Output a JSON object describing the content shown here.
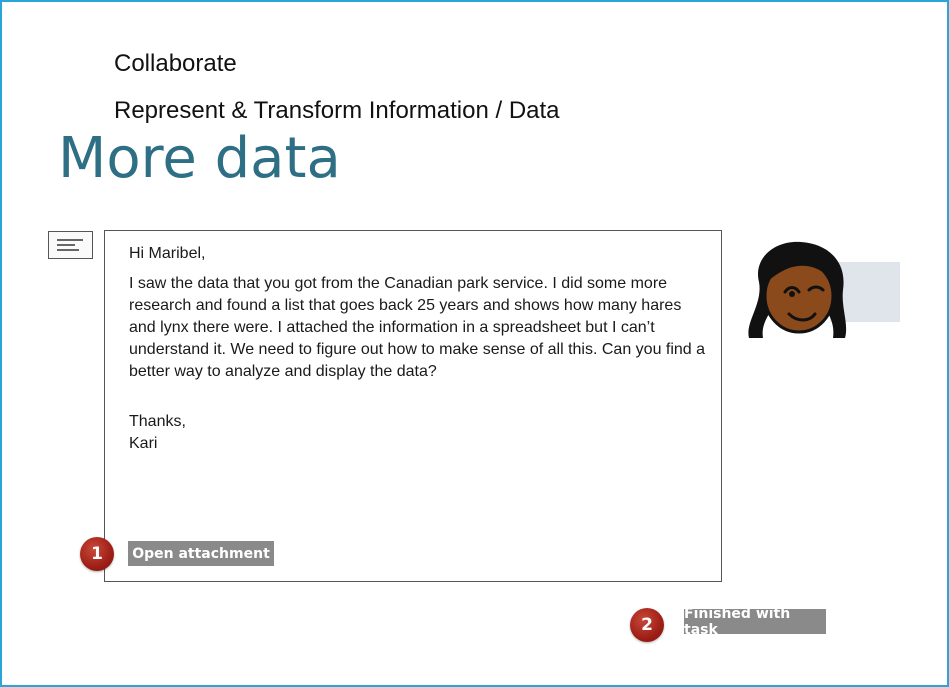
{
  "header": {
    "category": "Collaborate",
    "subcategory": "Represent & Transform Information / Data",
    "title": "More data"
  },
  "message": {
    "greeting": "Hi Maribel,",
    "body": "I saw the data that you got from the Canadian park service. I did some more research and found a list that goes back 25 years and shows how many hares and lynx there were. I attached the information in a spreadsheet but I can’t understand it. We need to figure out how to make sense of all this. Can you find a better way to analyze and display the data?",
    "signoff": "Thanks,",
    "signature": "Kari",
    "icon": "message-icon"
  },
  "steps": [
    {
      "number": "1",
      "label": "Open attachment"
    },
    {
      "number": "2",
      "label": "Finished with task"
    }
  ],
  "colors": {
    "border": "#2aa6d6",
    "title": "#2e6f86",
    "badge": "#9e1f16",
    "button": "#8a8a8a"
  }
}
